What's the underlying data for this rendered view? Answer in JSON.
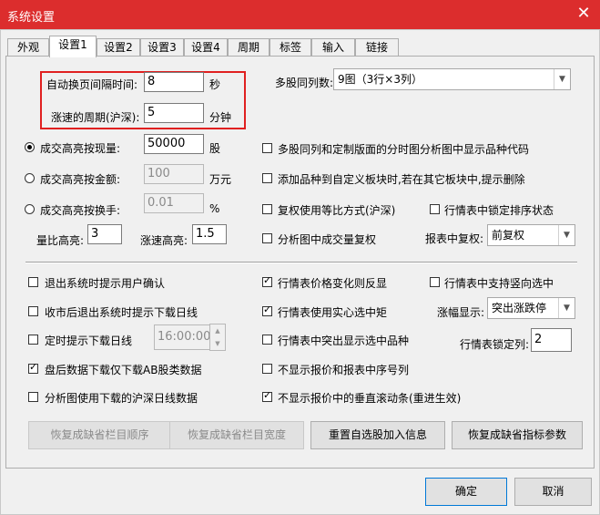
{
  "window": {
    "title": "系统设置",
    "close_glyph": "✕"
  },
  "tabs": [
    "外观",
    "设置1",
    "设置2",
    "设置3",
    "设置4",
    "周期",
    "标签",
    "输入",
    "链接"
  ],
  "top": {
    "auto_page_label": "自动换页间隔时间:",
    "auto_page_value": "8",
    "auto_page_unit": "秒",
    "rise_period_label": "涨速的周期(沪深):",
    "rise_period_value": "5",
    "rise_period_unit": "分钟",
    "multi_stock_label": "多股同列数:",
    "multi_stock_value": "9图（3行×3列）"
  },
  "highlight": {
    "vol_label": "成交高亮按现量:",
    "vol_value": "50000",
    "vol_unit": "股",
    "amt_label": "成交高亮按金额:",
    "amt_value": "100",
    "amt_unit": "万元",
    "turn_label": "成交高亮按换手:",
    "turn_value": "0.01",
    "turn_unit": "%",
    "ratio_label": "量比高亮:",
    "ratio_value": "3",
    "speed_label": "涨速高亮:",
    "speed_value": "1.5"
  },
  "right_opts": {
    "opt1": "多股同列和定制版面的分时图分析图中显示品种代码",
    "opt2": "添加品种到自定义板块时,若在其它板块中,提示删除",
    "opt3": "复权使用等比方式(沪深)",
    "opt4": "分析图中成交量复权",
    "opt5": "行情表中锁定排序状态",
    "fq_label": "报表中复权:",
    "fq_value": "前复权"
  },
  "lower": {
    "l1": "退出系统时提示用户确认",
    "l2": "收市后退出系统时提示下载日线",
    "l3": "定时提示下载日线",
    "l3_time": "16:00:00",
    "l4": "盘后数据下载仅下载AB股类数据",
    "l5": "分析图使用下载的沪深日线数据",
    "m1": "行情表价格变化则反显",
    "m2": "行情表使用实心选中矩",
    "m3": "行情表中突出显示选中品种",
    "m4": "不显示报价和报表中序号列",
    "m5": "不显示报价中的垂直滚动条(重进生效)",
    "r1": "行情表中支持竖向选中",
    "zf_label": "涨幅显示:",
    "zf_value": "突出涨跌停",
    "lock_label": "行情表锁定列:",
    "lock_value": "2"
  },
  "buttons": {
    "restore_order": "恢复成缺省栏目顺序",
    "restore_width": "恢复成缺省栏目宽度",
    "reset_self": "重置自选股加入信息",
    "restore_params": "恢复成缺省指标参数",
    "ok": "确定",
    "cancel": "取消"
  }
}
